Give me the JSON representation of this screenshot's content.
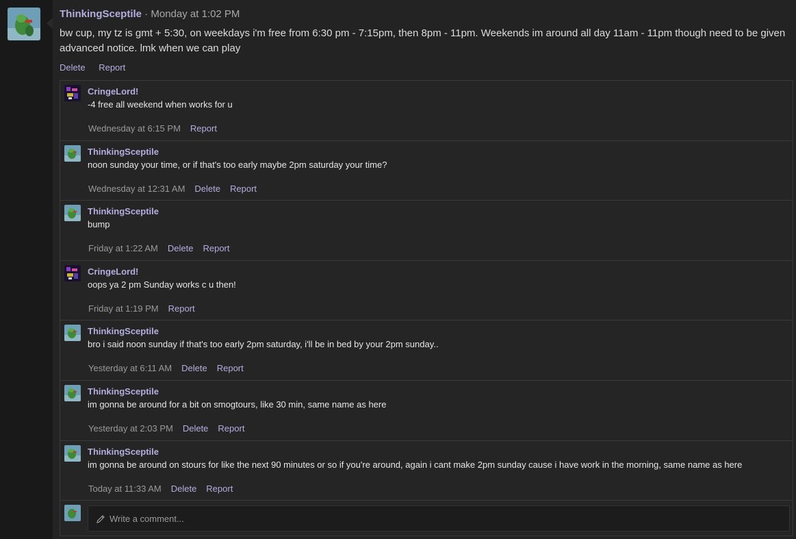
{
  "post": {
    "author": "ThinkingSceptile",
    "separator": " · ",
    "timestamp": "Monday at 1:02 PM",
    "body": "bw cup, my tz is gmt + 5:30, on weekdays i'm free from 6:30 pm - 7:15pm, then 8pm - 11pm. Weekends im around all day 11am - 11pm though need to be given advanced notice. lmk when we can play",
    "actions": {
      "delete": "Delete",
      "report": "Report"
    }
  },
  "comments": [
    {
      "author": "CringeLord!",
      "text": "-4 free all weekend when works for u",
      "time": "Wednesday at 6:15 PM",
      "delete": "",
      "report": "Report",
      "avatar": "cringelord-avatar"
    },
    {
      "author": "ThinkingSceptile",
      "text": "noon sunday your time, or if that's too early maybe 2pm saturday your time?",
      "time": "Wednesday at 12:31 AM",
      "delete": "Delete",
      "report": "Report",
      "avatar": "sceptile-avatar"
    },
    {
      "author": "ThinkingSceptile",
      "text": "bump",
      "time": "Friday at 1:22 AM",
      "delete": "Delete",
      "report": "Report",
      "avatar": "sceptile-avatar"
    },
    {
      "author": "CringeLord!",
      "text": "oops ya 2 pm Sunday works c u then!",
      "time": "Friday at 1:19 PM",
      "delete": "",
      "report": "Report",
      "avatar": "cringelord-avatar"
    },
    {
      "author": "ThinkingSceptile",
      "text": "bro i said noon sunday if that's too early 2pm saturday, i'll be in bed by your 2pm sunday..",
      "time": "Yesterday at 6:11 AM",
      "delete": "Delete",
      "report": "Report",
      "avatar": "sceptile-avatar"
    },
    {
      "author": "ThinkingSceptile",
      "text": "im gonna be around for a bit on smogtours, like 30 min, same name as here",
      "time": "Yesterday at 2:03 PM",
      "delete": "Delete",
      "report": "Report",
      "avatar": "sceptile-avatar"
    },
    {
      "author": "ThinkingSceptile",
      "text": "im gonna be around on stours for like the next 90 minutes or so if you're around, again i cant make 2pm sunday cause i have work in the morning, same name as here",
      "time": "Today at 11:33 AM",
      "delete": "Delete",
      "report": "Report",
      "avatar": "sceptile-avatar"
    }
  ],
  "reply": {
    "placeholder": "Write a comment..."
  },
  "colors": {
    "link": "#b4aee0",
    "background": "#232323",
    "panel": "#252525"
  }
}
